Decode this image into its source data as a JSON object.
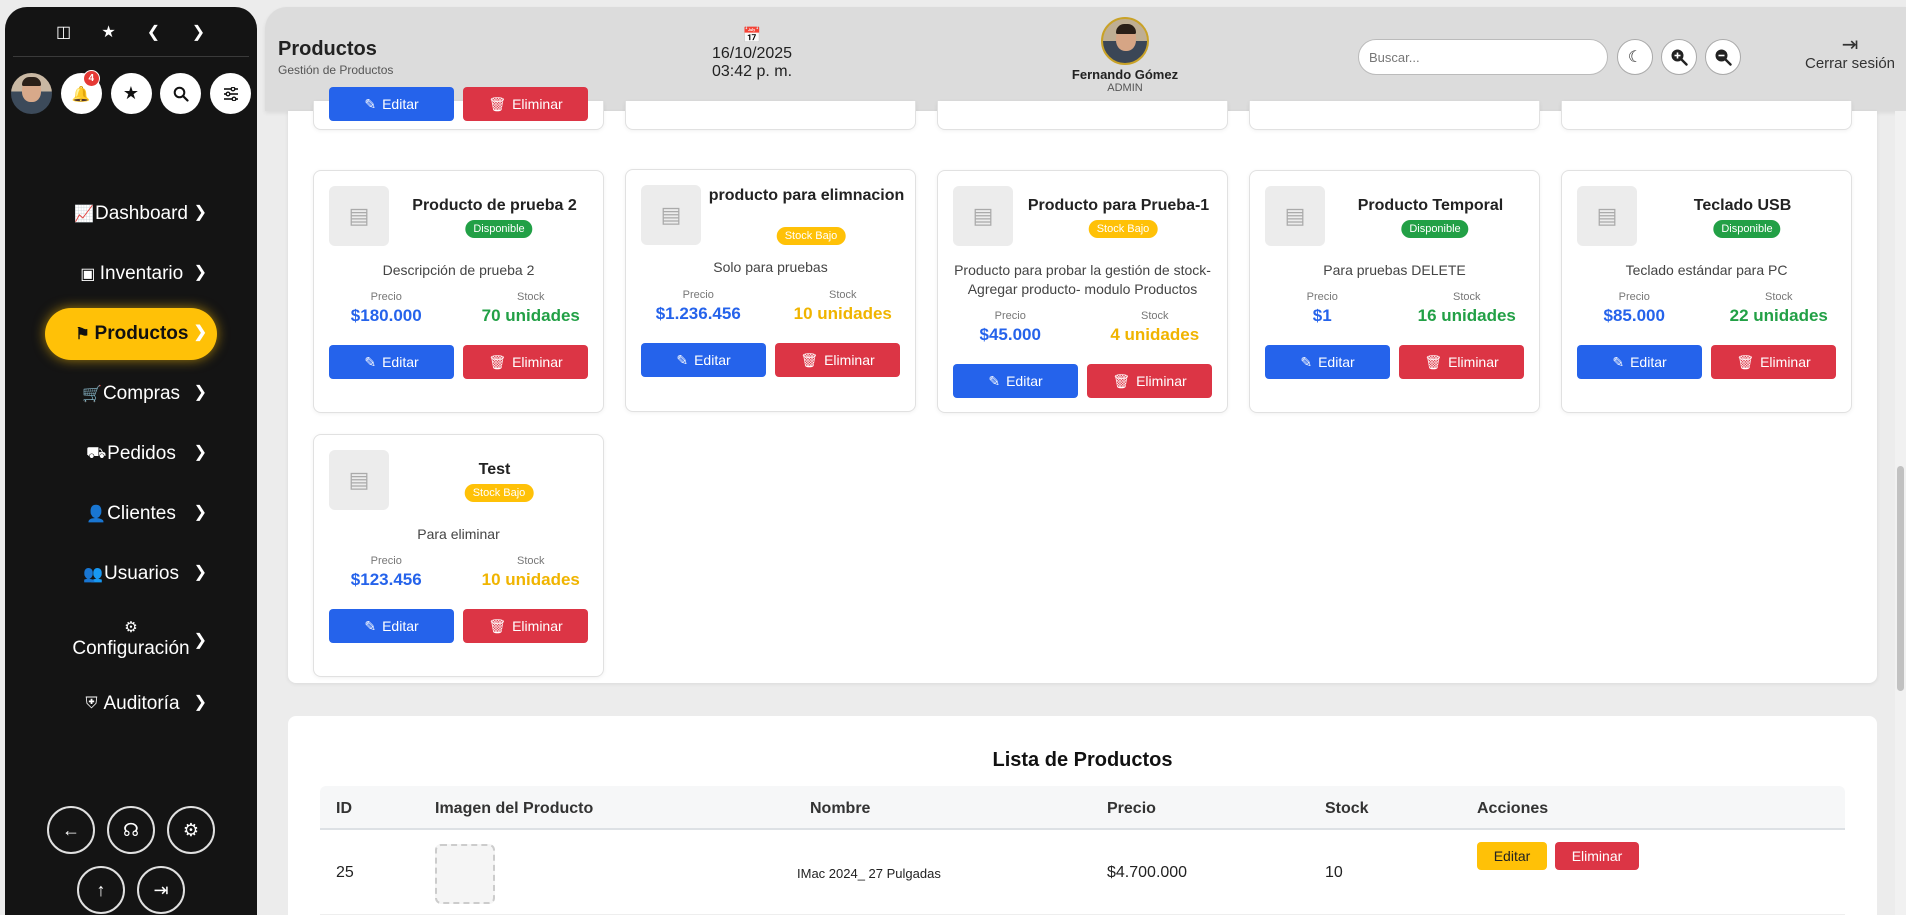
{
  "sidebar": {
    "notification_count": "4",
    "nav": [
      {
        "label": "Dashboard"
      },
      {
        "label": "Inventario"
      },
      {
        "label": "Productos"
      },
      {
        "label": "Compras"
      },
      {
        "label": "Pedidos"
      },
      {
        "label": "Clientes"
      },
      {
        "label": "Usuarios"
      },
      {
        "label": "Configuración"
      },
      {
        "label": "Auditoría"
      }
    ]
  },
  "header": {
    "title": "Productos",
    "subtitle": "Gestión de Productos",
    "date": "16/10/2025",
    "time": "03:42 p. m.",
    "user_name": "Fernando Gómez",
    "user_role": "ADMIN",
    "search_placeholder": "Buscar...",
    "logout_label": "Cerrar sesión"
  },
  "top_row_buttons": {
    "edit": "Editar",
    "delete": "Eliminar"
  },
  "cards": [
    {
      "name": "Producto de prueba 2",
      "status": "Disponible",
      "description": "Descripción de prueba 2",
      "price_label": "Precio",
      "price": "$180.000",
      "stock_label": "Stock",
      "stock": "70 unidades",
      "edit": "Editar",
      "delete": "Eliminar"
    },
    {
      "name": "producto para elimnacion",
      "status": "Stock Bajo",
      "description": "Solo para pruebas",
      "price_label": "Precio",
      "price": "$1.236.456",
      "stock_label": "Stock",
      "stock": "10 unidades",
      "edit": "Editar",
      "delete": "Eliminar"
    },
    {
      "name": "Producto para Prueba-1",
      "status": "Stock Bajo",
      "description": "Producto para probar la gestión de stock- Agregar producto- modulo Productos",
      "price_label": "Precio",
      "price": "$45.000",
      "stock_label": "Stock",
      "stock": "4 unidades",
      "edit": "Editar",
      "delete": "Eliminar"
    },
    {
      "name": "Producto Temporal",
      "status": "Disponible",
      "description": "Para pruebas DELETE",
      "price_label": "Precio",
      "price": "$1",
      "stock_label": "Stock",
      "stock": "16 unidades",
      "edit": "Editar",
      "delete": "Eliminar"
    },
    {
      "name": "Teclado USB",
      "status": "Disponible",
      "description": "Teclado estándar para PC",
      "price_label": "Precio",
      "price": "$85.000",
      "stock_label": "Stock",
      "stock": "22 unidades",
      "edit": "Editar",
      "delete": "Eliminar"
    },
    {
      "name": "Test",
      "status": "Stock Bajo",
      "description": "Para eliminar",
      "price_label": "Precio",
      "price": "$123.456",
      "stock_label": "Stock",
      "stock": "10 unidades",
      "edit": "Editar",
      "delete": "Eliminar"
    }
  ],
  "list": {
    "title": "Lista de Productos",
    "columns": [
      "ID",
      "Imagen del Producto",
      "Nombre",
      "Precio",
      "Stock",
      "Acciones"
    ],
    "rows": [
      {
        "id": "25",
        "name": "IMac 2024_ 27 Pulgadas",
        "price": "$4.700.000",
        "stock": "10",
        "edit": "Editar",
        "delete": "Eliminar"
      }
    ]
  },
  "colors": {
    "accent": "#ffc107",
    "primary": "#2563eb",
    "danger": "#dc3545",
    "success": "#22a046",
    "sidebar_bg": "#141414"
  }
}
